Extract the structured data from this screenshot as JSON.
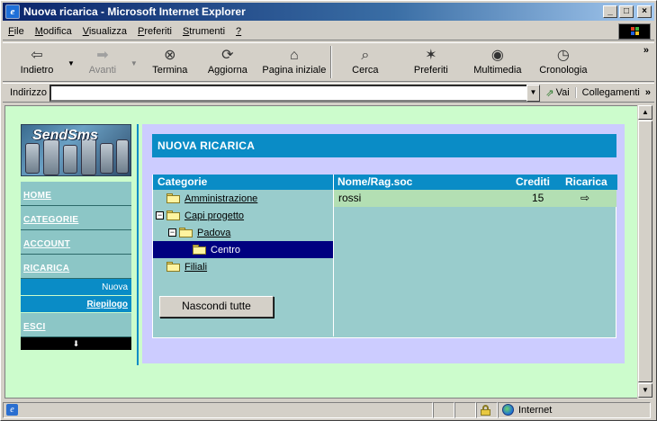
{
  "window": {
    "title": "Nuova ricarica - Microsoft Internet Explorer",
    "controls": {
      "minimize": "_",
      "maximize": "□",
      "close": "×"
    }
  },
  "menubar": {
    "items": [
      {
        "pre": "",
        "key": "F",
        "post": "ile"
      },
      {
        "pre": "",
        "key": "M",
        "post": "odifica"
      },
      {
        "pre": "",
        "key": "V",
        "post": "isualizza"
      },
      {
        "pre": "",
        "key": "P",
        "post": "referiti"
      },
      {
        "pre": "",
        "key": "S",
        "post": "trumenti"
      },
      {
        "pre": "",
        "key": "?",
        "post": ""
      }
    ]
  },
  "toolbar": {
    "back": {
      "label": "Indietro",
      "icon": "back-arrow-icon",
      "glyph": "⇦"
    },
    "forward": {
      "label": "Avanti",
      "icon": "forward-arrow-icon",
      "glyph": "➡"
    },
    "stop": {
      "label": "Termina",
      "icon": "stop-icon",
      "glyph": "⊗"
    },
    "refresh": {
      "label": "Aggiorna",
      "icon": "refresh-icon",
      "glyph": "⟳"
    },
    "home": {
      "label": "Pagina iniziale",
      "icon": "home-icon",
      "glyph": "⌂"
    },
    "search": {
      "label": "Cerca",
      "icon": "search-icon",
      "glyph": "⌕"
    },
    "favorites": {
      "label": "Preferiti",
      "icon": "favorites-icon",
      "glyph": "✶"
    },
    "media": {
      "label": "Multimedia",
      "icon": "media-icon",
      "glyph": "◉"
    },
    "history": {
      "label": "Cronologia",
      "icon": "history-icon",
      "glyph": "◷"
    },
    "dropdown_glyph": "▼",
    "more": "»"
  },
  "addressbar": {
    "label": "Indirizzo",
    "value": "",
    "go_label": "Vai",
    "go_glyph": "⇗",
    "links_label": "Collegamenti",
    "links_more": "»",
    "drop_glyph": "▼"
  },
  "page": {
    "logo_text": "SendSms",
    "nav": {
      "home": "HOME",
      "categorie": "CATEGORIE",
      "account": "ACCOUNT",
      "ricarica": "RICARICA",
      "nuova": "Nuova",
      "riepilogo": "Riepilogo",
      "esci": "ESCI",
      "bottom_glyph": "⬇"
    },
    "panel_title": "NUOVA RICARICA",
    "grid": {
      "headers": {
        "categorie": "Categorie",
        "nome": "Nome/Rag.soc",
        "crediti": "Crediti",
        "ricarica": "Ricarica"
      },
      "tree": [
        {
          "label": "Amministrazione",
          "expander": "",
          "level": 0,
          "selected": false
        },
        {
          "label": "Capi progetto",
          "expander": "−",
          "level": 0,
          "selected": false
        },
        {
          "label": "Padova",
          "expander": "−",
          "level": 1,
          "selected": false
        },
        {
          "label": "Centro",
          "expander": "",
          "level": 2,
          "selected": true
        },
        {
          "label": "Filiali",
          "expander": "",
          "level": 0,
          "selected": false
        }
      ],
      "rows": [
        {
          "nome": "rossi",
          "crediti": "15",
          "ricarica_glyph": "⇨"
        }
      ],
      "hide_button": "Nascondi tutte"
    }
  },
  "statusbar": {
    "text": "",
    "zone": "Internet",
    "ie_glyph": "e"
  },
  "colors": {
    "page_bg": "#ccfccc",
    "accent": "#0a8cc6",
    "panel_bg": "#ccccff",
    "grid_bg": "#99cccc",
    "selected_row": "#000080"
  }
}
